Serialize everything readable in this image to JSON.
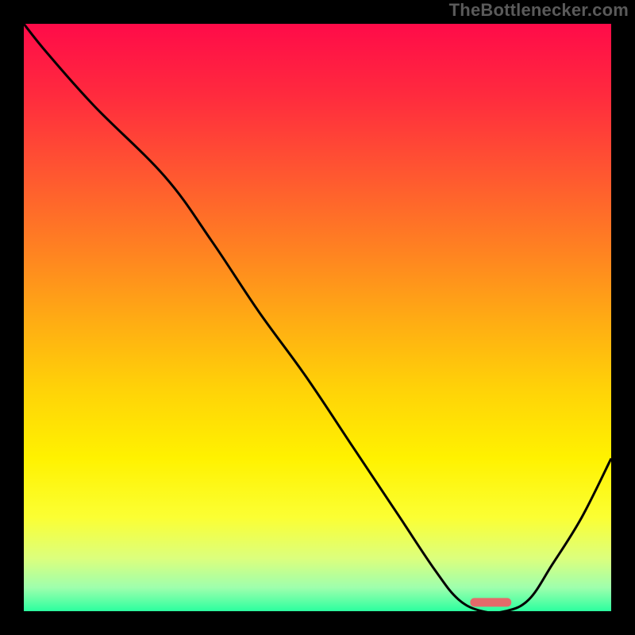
{
  "attribution": "TheBottlenecker.com",
  "chart_data": {
    "type": "line",
    "title": "",
    "xlabel": "",
    "ylabel": "",
    "xlim": [
      0,
      100
    ],
    "ylim": [
      0,
      100
    ],
    "x": [
      0,
      4,
      12,
      24,
      32,
      40,
      48,
      56,
      64,
      70,
      74,
      78,
      82,
      86,
      90,
      95,
      100
    ],
    "values": [
      100,
      95,
      86,
      74,
      63,
      51,
      40,
      28,
      16,
      7,
      2,
      0,
      0,
      2,
      8,
      16,
      26
    ],
    "marker": {
      "x_start": 76,
      "x_end": 83,
      "y": 1.5
    },
    "gradient_stops": [
      {
        "offset": 0.0,
        "color": "#ff0b49"
      },
      {
        "offset": 0.12,
        "color": "#ff2a3e"
      },
      {
        "offset": 0.25,
        "color": "#ff5531"
      },
      {
        "offset": 0.38,
        "color": "#ff8022"
      },
      {
        "offset": 0.5,
        "color": "#ffaa14"
      },
      {
        "offset": 0.62,
        "color": "#ffd208"
      },
      {
        "offset": 0.74,
        "color": "#fff200"
      },
      {
        "offset": 0.84,
        "color": "#fbff33"
      },
      {
        "offset": 0.91,
        "color": "#dcff7d"
      },
      {
        "offset": 0.96,
        "color": "#9effad"
      },
      {
        "offset": 1.0,
        "color": "#2bff9f"
      }
    ]
  }
}
